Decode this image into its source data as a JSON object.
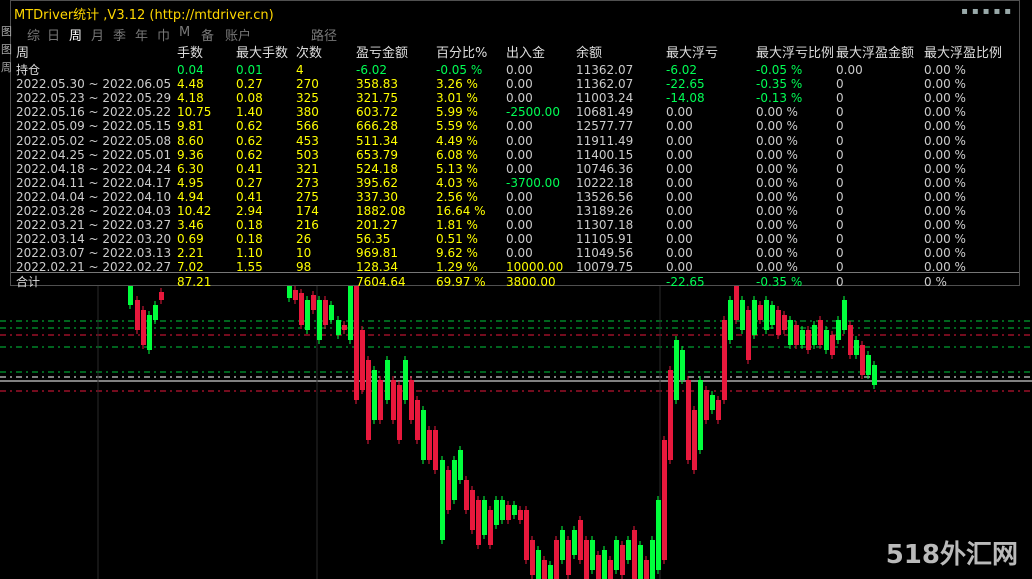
{
  "window": {
    "title": "MTDriver统计 ,V3.12 (http://mtdriver.cn)",
    "title_right_glyphs": "▪▪▪▪▪",
    "side_strip": [
      "图",
      "图",
      "周"
    ]
  },
  "tabs": [
    {
      "label": "综",
      "active": false
    },
    {
      "label": "日",
      "active": false
    },
    {
      "label": "周",
      "active": true
    },
    {
      "label": "月",
      "active": false
    },
    {
      "label": "季",
      "active": false
    },
    {
      "label": "年",
      "active": false
    },
    {
      "label": "巾",
      "active": false
    },
    {
      "label": "M",
      "active": false
    },
    {
      "label": "备",
      "active": false
    },
    {
      "label": "账户",
      "active": false
    }
  ],
  "menu_link": "路径",
  "columns": [
    "周",
    "手数",
    "最大手数",
    "次数",
    "盈亏金额",
    "百分比%",
    "出入金",
    "余额",
    "最大浮亏",
    "最大浮亏比例",
    "最大浮盈金额",
    "最大浮盈比例"
  ],
  "rows": [
    {
      "period": "持仓",
      "lots": "0.04",
      "max_lots": "0.01",
      "count": "4",
      "pnl": "-6.02",
      "pct": "-0.05 %",
      "io": "0.00",
      "balance": "11362.07",
      "max_float_loss": "-6.02",
      "max_float_loss_pct": "-0.05 %",
      "max_float_profit": "0.00",
      "max_float_profit_pct": "0.00 %",
      "kind": "open"
    },
    {
      "period": "2022.05.30 ~ 2022.06.05",
      "lots": "4.48",
      "max_lots": "0.27",
      "count": "270",
      "pnl": "358.83",
      "pct": "3.26 %",
      "io": "0.00",
      "balance": "11362.07",
      "max_float_loss": "-22.65",
      "max_float_loss_pct": "-0.35 %",
      "max_float_profit": "0",
      "max_float_profit_pct": "0.00 %",
      "kind": "week"
    },
    {
      "period": "2022.05.23 ~ 2022.05.29",
      "lots": "4.18",
      "max_lots": "0.08",
      "count": "325",
      "pnl": "321.75",
      "pct": "3.01 %",
      "io": "0.00",
      "balance": "11003.24",
      "max_float_loss": "-14.08",
      "max_float_loss_pct": "-0.13 %",
      "max_float_profit": "0",
      "max_float_profit_pct": "0.00 %",
      "kind": "week"
    },
    {
      "period": "2022.05.16 ~ 2022.05.22",
      "lots": "10.75",
      "max_lots": "1.40",
      "count": "380",
      "pnl": "603.72",
      "pct": "5.99 %",
      "io": "-2500.00",
      "balance": "10681.49",
      "max_float_loss": "0.00",
      "max_float_loss_pct": "0.00 %",
      "max_float_profit": "0",
      "max_float_profit_pct": "0.00 %",
      "kind": "week"
    },
    {
      "period": "2022.05.09 ~ 2022.05.15",
      "lots": "9.81",
      "max_lots": "0.62",
      "count": "566",
      "pnl": "666.28",
      "pct": "5.59 %",
      "io": "0.00",
      "balance": "12577.77",
      "max_float_loss": "0.00",
      "max_float_loss_pct": "0.00 %",
      "max_float_profit": "0",
      "max_float_profit_pct": "0.00 %",
      "kind": "week"
    },
    {
      "period": "2022.05.02 ~ 2022.05.08",
      "lots": "8.60",
      "max_lots": "0.62",
      "count": "453",
      "pnl": "511.34",
      "pct": "4.49 %",
      "io": "0.00",
      "balance": "11911.49",
      "max_float_loss": "0.00",
      "max_float_loss_pct": "0.00 %",
      "max_float_profit": "0",
      "max_float_profit_pct": "0.00 %",
      "kind": "week"
    },
    {
      "period": "2022.04.25 ~ 2022.05.01",
      "lots": "9.36",
      "max_lots": "0.62",
      "count": "503",
      "pnl": "653.79",
      "pct": "6.08 %",
      "io": "0.00",
      "balance": "11400.15",
      "max_float_loss": "0.00",
      "max_float_loss_pct": "0.00 %",
      "max_float_profit": "0",
      "max_float_profit_pct": "0.00 %",
      "kind": "week"
    },
    {
      "period": "2022.04.18 ~ 2022.04.24",
      "lots": "6.30",
      "max_lots": "0.41",
      "count": "321",
      "pnl": "524.18",
      "pct": "5.13 %",
      "io": "0.00",
      "balance": "10746.36",
      "max_float_loss": "0.00",
      "max_float_loss_pct": "0.00 %",
      "max_float_profit": "0",
      "max_float_profit_pct": "0.00 %",
      "kind": "week"
    },
    {
      "period": "2022.04.11 ~ 2022.04.17",
      "lots": "4.95",
      "max_lots": "0.27",
      "count": "273",
      "pnl": "395.62",
      "pct": "4.03 %",
      "io": "-3700.00",
      "balance": "10222.18",
      "max_float_loss": "0.00",
      "max_float_loss_pct": "0.00 %",
      "max_float_profit": "0",
      "max_float_profit_pct": "0.00 %",
      "kind": "week"
    },
    {
      "period": "2022.04.04 ~ 2022.04.10",
      "lots": "4.94",
      "max_lots": "0.41",
      "count": "275",
      "pnl": "337.30",
      "pct": "2.56 %",
      "io": "0.00",
      "balance": "13526.56",
      "max_float_loss": "0.00",
      "max_float_loss_pct": "0.00 %",
      "max_float_profit": "0",
      "max_float_profit_pct": "0.00 %",
      "kind": "week"
    },
    {
      "period": "2022.03.28 ~ 2022.04.03",
      "lots": "10.42",
      "max_lots": "2.94",
      "count": "174",
      "pnl": "1882.08",
      "pct": "16.64 %",
      "io": "0.00",
      "balance": "13189.26",
      "max_float_loss": "0.00",
      "max_float_loss_pct": "0.00 %",
      "max_float_profit": "0",
      "max_float_profit_pct": "0.00 %",
      "kind": "week"
    },
    {
      "period": "2022.03.21 ~ 2022.03.27",
      "lots": "3.46",
      "max_lots": "0.18",
      "count": "216",
      "pnl": "201.27",
      "pct": "1.81 %",
      "io": "0.00",
      "balance": "11307.18",
      "max_float_loss": "0.00",
      "max_float_loss_pct": "0.00 %",
      "max_float_profit": "0",
      "max_float_profit_pct": "0.00 %",
      "kind": "week"
    },
    {
      "period": "2022.03.14 ~ 2022.03.20",
      "lots": "0.69",
      "max_lots": "0.18",
      "count": "26",
      "pnl": "56.35",
      "pct": "0.51 %",
      "io": "0.00",
      "balance": "11105.91",
      "max_float_loss": "0.00",
      "max_float_loss_pct": "0.00 %",
      "max_float_profit": "0",
      "max_float_profit_pct": "0.00 %",
      "kind": "week"
    },
    {
      "period": "2022.03.07 ~ 2022.03.13",
      "lots": "2.21",
      "max_lots": "1.10",
      "count": "10",
      "pnl": "969.81",
      "pct": "9.62 %",
      "io": "0.00",
      "balance": "11049.56",
      "max_float_loss": "0.00",
      "max_float_loss_pct": "0.00 %",
      "max_float_profit": "0",
      "max_float_profit_pct": "0.00 %",
      "kind": "week"
    },
    {
      "period": "2022.02.21 ~ 2022.02.27",
      "lots": "7.02",
      "max_lots": "1.55",
      "count": "98",
      "pnl": "128.34",
      "pct": "1.29 %",
      "io": "10000.00",
      "balance": "10079.75",
      "max_float_loss": "0.00",
      "max_float_loss_pct": "0.00 %",
      "max_float_profit": "0",
      "max_float_profit_pct": "0.00 %",
      "kind": "week"
    }
  ],
  "totals": {
    "label": "合计",
    "lots": "87.21",
    "pnl": "7604.64",
    "pct": "69.97 %",
    "io": "3800.00",
    "max_float_loss": "-22.65",
    "max_float_loss_pct": "-0.35 %",
    "max_float_profit": "0",
    "max_float_profit_pct": "0 %"
  },
  "watermark": "518外汇网",
  "colors": {
    "bull": "#00ff3c",
    "bear": "#e8183c",
    "value_yellow": "#ffff00",
    "value_green": "#00ff55"
  }
}
